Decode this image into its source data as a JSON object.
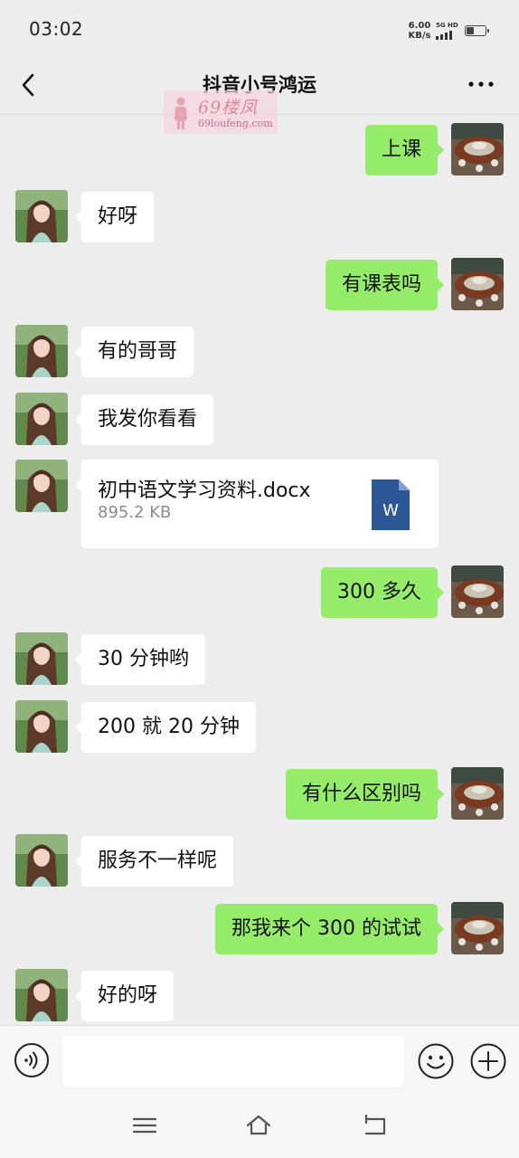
{
  "status_bar": {
    "time": "03:02",
    "net_speed": "6.00",
    "net_unit": "KB/s",
    "signal_label": "5G HD",
    "battery_percent": 40
  },
  "header": {
    "title": "抖音小号鸿运"
  },
  "watermark": {
    "brand": "69楼凤",
    "url": "69loufeng.com"
  },
  "messages": [
    {
      "side": "out",
      "text": "上课"
    },
    {
      "side": "in",
      "text": "好呀"
    },
    {
      "side": "out",
      "text": "有课表吗"
    },
    {
      "side": "in",
      "text": "有的哥哥"
    },
    {
      "side": "in",
      "text": "我发你看看"
    },
    {
      "side": "in",
      "type": "file",
      "file_name": "初中语文学习资料.docx",
      "file_size": "895.2 KB",
      "file_icon_letter": "W"
    },
    {
      "side": "out",
      "text": "300 多久"
    },
    {
      "side": "in",
      "text": "30 分钟哟"
    },
    {
      "side": "in",
      "text": "200 就 20 分钟"
    },
    {
      "side": "out",
      "text": "有什么区别吗"
    },
    {
      "side": "in",
      "text": "服务不一样呢"
    },
    {
      "side": "out",
      "text": "那我来个 300 的试试"
    },
    {
      "side": "in",
      "text": "好的呀"
    }
  ],
  "colors": {
    "background": "#ededed",
    "bubble_out": "#95ec69",
    "bubble_in": "#ffffff",
    "word_blue": "#2b5797"
  },
  "icons": {
    "back": "chevron-left-icon",
    "more": "more-dots-icon",
    "voice": "voice-icon",
    "emoji": "emoji-icon",
    "plus": "plus-icon"
  }
}
